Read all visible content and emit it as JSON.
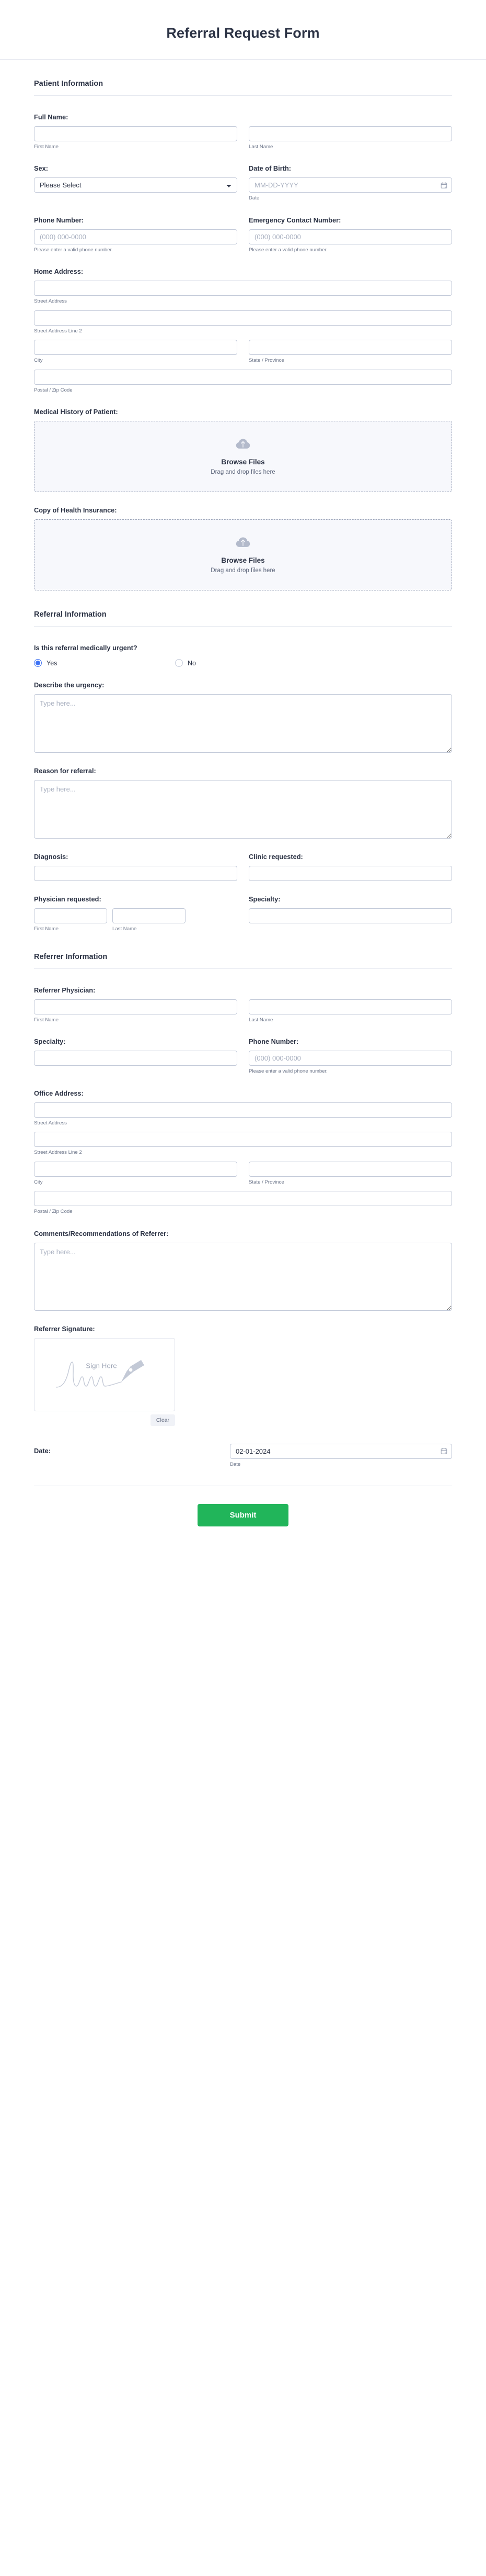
{
  "header": {
    "title": "Referral Request Form"
  },
  "sections": {
    "patient": {
      "heading": "Patient Information"
    },
    "referral": {
      "heading": "Referral Information"
    },
    "referrer": {
      "heading": "Referrer Information"
    }
  },
  "patient": {
    "full_name": {
      "label": "Full Name:",
      "first_sub": "First Name",
      "last_sub": "Last Name",
      "first_value": "",
      "last_value": ""
    },
    "sex": {
      "label": "Sex:",
      "selected": "Please Select",
      "options": [
        "Please Select"
      ]
    },
    "dob": {
      "label": "Date of Birth:",
      "placeholder": "MM-DD-YYYY",
      "value": "",
      "sub": "Date",
      "icon": "calendar-icon"
    },
    "phone": {
      "label": "Phone Number:",
      "placeholder": "(000) 000-0000",
      "value": "",
      "sub": "Please enter a valid phone number."
    },
    "emergency_phone": {
      "label": "Emergency Contact Number:",
      "placeholder": "(000) 000-0000",
      "value": "",
      "sub": "Please enter a valid phone number."
    },
    "home_address": {
      "label": "Home Address:",
      "street_sub": "Street Address",
      "street2_sub": "Street Address Line 2",
      "city_sub": "City",
      "state_sub": "State / Province",
      "postal_sub": "Postal / Zip Code",
      "street_value": "",
      "street2_value": "",
      "city_value": "",
      "state_value": "",
      "postal_value": ""
    },
    "medical_history": {
      "label": "Medical History of Patient:",
      "browse": "Browse Files",
      "drag": "Drag and drop files here",
      "icon": "cloud-upload-icon"
    },
    "health_insurance": {
      "label": "Copy of Health Insurance:",
      "browse": "Browse Files",
      "drag": "Drag and drop files here",
      "icon": "cloud-upload-icon"
    }
  },
  "referral": {
    "urgent": {
      "label": "Is this referral medically urgent?",
      "yes_label": "Yes",
      "no_label": "No",
      "selected": "Yes"
    },
    "urgency_desc": {
      "label": "Describe the urgency:",
      "placeholder": "Type here...",
      "value": ""
    },
    "reason": {
      "label": "Reason for referral:",
      "placeholder": "Type here...",
      "value": ""
    },
    "diagnosis": {
      "label": "Diagnosis:",
      "value": ""
    },
    "clinic_requested": {
      "label": "Clinic requested:",
      "value": ""
    },
    "physician_requested": {
      "label": "Physician requested:",
      "first_sub": "First Name",
      "last_sub": "Last Name",
      "first_value": "",
      "last_value": ""
    },
    "specialty": {
      "label": "Specialty:",
      "value": ""
    }
  },
  "referrer": {
    "physician": {
      "label": "Referrer Physician:",
      "first_sub": "First Name",
      "last_sub": "Last Name",
      "first_value": "",
      "last_value": ""
    },
    "specialty": {
      "label": "Specialty:",
      "value": ""
    },
    "phone": {
      "label": "Phone Number:",
      "placeholder": "(000) 000-0000",
      "value": "",
      "sub": "Please enter a valid phone number."
    },
    "office_address": {
      "label": "Office Address:",
      "street_sub": "Street Address",
      "street2_sub": "Street Address Line 2",
      "city_sub": "City",
      "state_sub": "State / Province",
      "postal_sub": "Postal / Zip Code",
      "street_value": "",
      "street2_value": "",
      "city_value": "",
      "state_value": "",
      "postal_value": ""
    },
    "comments": {
      "label": "Comments/Recommendations of Referrer:",
      "placeholder": "Type here...",
      "value": ""
    },
    "signature": {
      "label": "Referrer Signature:",
      "sign_here": "Sign Here",
      "clear_label": "Clear",
      "icon": "signature-pen-icon"
    },
    "date": {
      "label": "Date:",
      "value": "02-01-2024",
      "sub": "Date",
      "icon": "calendar-icon"
    }
  },
  "footer": {
    "submit_label": "Submit"
  },
  "colors": {
    "accent_blue": "#3d72f5",
    "submit_green": "#21b55a",
    "heading_navy": "#2c3345",
    "border_grey": "#c3cad9",
    "sub_text": "#6c7589"
  }
}
